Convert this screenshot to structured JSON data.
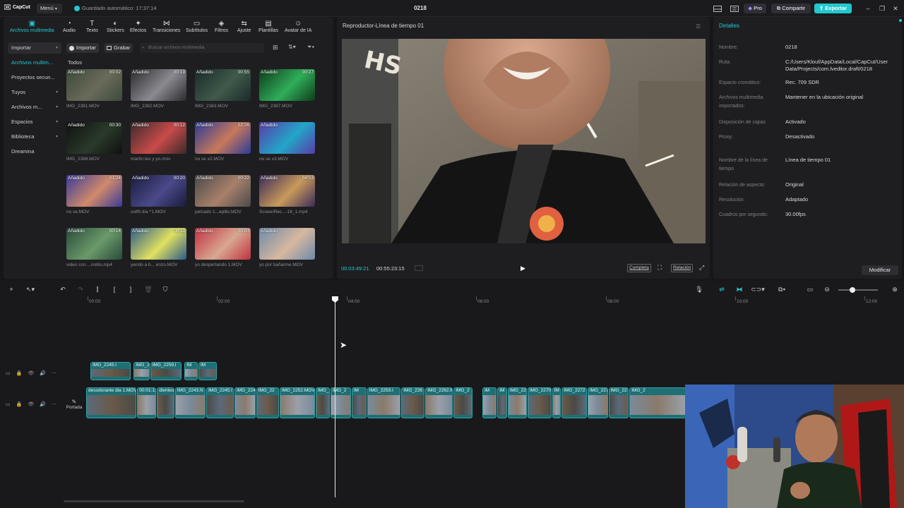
{
  "topbar": {
    "logo": "CapCut",
    "menu": "Menú",
    "autosave": "Guardado automático: 17:37:14",
    "project_name": "0218",
    "pro": "Pro",
    "share": "Compartir",
    "export": "Exportar"
  },
  "toolbar": [
    {
      "label": "Archivos multimedia",
      "icon": "media-icon",
      "active": true
    },
    {
      "label": "Audio",
      "icon": "audio-icon"
    },
    {
      "label": "Texto",
      "icon": "text-icon"
    },
    {
      "label": "Stickers",
      "icon": "stickers-icon"
    },
    {
      "label": "Efectos",
      "icon": "effects-icon"
    },
    {
      "label": "Transiciones",
      "icon": "transitions-icon"
    },
    {
      "label": "Subtítulos",
      "icon": "subtitles-icon"
    },
    {
      "label": "Filtros",
      "icon": "filters-icon"
    },
    {
      "label": "Ajuste",
      "icon": "adjust-icon"
    },
    {
      "label": "Plantillas",
      "icon": "templates-icon"
    },
    {
      "label": "Avatar de IA",
      "icon": "ai-avatar-icon"
    }
  ],
  "sidebar": [
    {
      "label": "Importar",
      "chevron": true,
      "selected": true
    },
    {
      "label": "Archivos multim...",
      "active": true
    },
    {
      "label": "Proyectos secun..."
    },
    {
      "label": "Tuyos",
      "chevron": true
    },
    {
      "label": "Archivos m...",
      "chevron": true
    },
    {
      "label": "Espacios",
      "chevron": true
    },
    {
      "label": "Biblioteca",
      "chevron": true
    },
    {
      "label": "Dreamina"
    }
  ],
  "media_panel": {
    "import_btn": "Importar",
    "record_btn": "Grabar",
    "search_placeholder": "Buscar archivos multimedia",
    "section": "Todos",
    "added_label": "Añadido",
    "clips": [
      {
        "name": "IMG_2381.MOV",
        "duration": "00:02",
        "colors": [
          "#3c4a3a",
          "#6a6a5a"
        ]
      },
      {
        "name": "IMG_2382.MOV",
        "duration": "00:19",
        "colors": [
          "#2a2a2e",
          "#8a8a90"
        ]
      },
      {
        "name": "IMG_2383.MOV",
        "duration": "00:55",
        "colors": [
          "#1a2a2a",
          "#3f5a4a"
        ]
      },
      {
        "name": "IMG_2387.MOV",
        "duration": "00:27",
        "colors": [
          "#0f3a1a",
          "#2fae5a"
        ]
      },
      {
        "name": "IMG_2388.MOV",
        "duration": "00:30",
        "colors": [
          "#101010",
          "#2a3a2a"
        ]
      },
      {
        "name": "martin leo y yo.mov",
        "duration": "00:12",
        "colors": [
          "#3a2a2a",
          "#c94a4a"
        ]
      },
      {
        "name": "no se x2.MOV",
        "duration": "02:26",
        "colors": [
          "#2a3a9a",
          "#c8785a"
        ]
      },
      {
        "name": "no se x3.MOV",
        "duration": "",
        "colors": [
          "#5a3aaa",
          "#22a6c8"
        ]
      },
      {
        "name": "no se.MOV",
        "duration": "01:24",
        "colors": [
          "#3a3a9a",
          "#d08a6a"
        ]
      },
      {
        "name": "outfit dia ^1.MOV",
        "duration": "00:20",
        "colors": [
          "#1a1a3a",
          "#4a4a8a"
        ]
      },
      {
        "name": "peinado 1...epillo.MOV",
        "duration": "00:22",
        "colors": [
          "#4a4a4a",
          "#a8806a"
        ]
      },
      {
        "name": "ScreenRec...-16_1.mp4",
        "duration": "04:53",
        "colors": [
          "#3a2a5a",
          "#c89a5a"
        ]
      },
      {
        "name": "video con ...nolito.mp4",
        "duration": "00:14",
        "colors": [
          "#2a4a3a",
          "#6a9a6a"
        ]
      },
      {
        "name": "yendo a b... enzo.MOV",
        "duration": "00:11",
        "colors": [
          "#2a5a8a",
          "#e0e060"
        ]
      },
      {
        "name": "yo despertando 1.MOV",
        "duration": "00:03",
        "colors": [
          "#c03040",
          "#d8a890"
        ]
      },
      {
        "name": "yo por bañarme.MOV",
        "duration": "",
        "colors": [
          "#6a8aaa",
          "#d8b8a0"
        ]
      }
    ]
  },
  "player": {
    "title": "Reproductor-Línea de tiempo 01",
    "current_time": "00:03:49:21",
    "total_time": "00:55:23:15",
    "full_btn": "Completa",
    "ratio_btn": "Relación"
  },
  "details": {
    "title": "Detalles",
    "rows": [
      {
        "label": "Nombre:",
        "value": "0218"
      },
      {
        "label": "Ruta:",
        "value": "C:/Users/Klouf/AppData/Local/CapCut/User Data/Projects/com.lveditor.draft/0218"
      },
      {
        "label": "Espacio cromático:",
        "value": "Rec. 709 SDR"
      },
      {
        "label": "Archivos multimedia importados:",
        "value": "Mantener en la ubicación original"
      },
      {
        "label": "Disposición de capas",
        "value": "Activado"
      },
      {
        "label": "Proxy:",
        "value": "Desactivado"
      },
      {
        "label": "Nombre de la línea de tiempo",
        "value": "Línea de tiempo 01"
      },
      {
        "label": "Relación de aspecto:",
        "value": "Original"
      },
      {
        "label": "Resolución:",
        "value": "Adaptado"
      },
      {
        "label": "Cuadros por segundo:",
        "value": "30.00fps"
      }
    ],
    "modify_btn": "Modificar"
  },
  "timeline": {
    "ruler": [
      "00:00",
      "02:00",
      "04:00",
      "06:00",
      "08:00",
      "10:00",
      "12:00"
    ],
    "cover_label": "Portada",
    "overlay_clips": [
      {
        "label": "IMG_2245.I",
        "start": 0.0,
        "end": 0.32
      },
      {
        "label": "IMG_2",
        "start": 0.34,
        "end": 0.47
      },
      {
        "label": "IMG_2259.I",
        "start": 0.47,
        "end": 0.72
      },
      {
        "label": "IM",
        "start": 0.74,
        "end": 0.85
      },
      {
        "label": "IM",
        "start": 0.85,
        "end": 1.0
      }
    ],
    "main_clips": [
      {
        "label": "desodorante dia 1.MOV",
        "start": 0.0,
        "end": 0.085
      },
      {
        "label": "00:01:11",
        "start": 0.085,
        "end": 0.118
      },
      {
        "label": "dientes i",
        "start": 0.118,
        "end": 0.148
      },
      {
        "label": "IMG_2243.N",
        "start": 0.148,
        "end": 0.2
      },
      {
        "label": "IMG_2245.I",
        "start": 0.2,
        "end": 0.247
      },
      {
        "label": "IMG_224",
        "start": 0.247,
        "end": 0.283
      },
      {
        "label": "IMG_22",
        "start": 0.283,
        "end": 0.322
      },
      {
        "label": "IMG_2252.MOV",
        "start": 0.322,
        "end": 0.382
      },
      {
        "label": "IMG_",
        "start": 0.382,
        "end": 0.407
      },
      {
        "label": "IMG_2",
        "start": 0.407,
        "end": 0.442
      },
      {
        "label": "IM",
        "start": 0.442,
        "end": 0.468
      },
      {
        "label": "IMG_2259.I",
        "start": 0.468,
        "end": 0.525
      },
      {
        "label": "IMG_226",
        "start": 0.525,
        "end": 0.565
      },
      {
        "label": "IMG_2262.MOV",
        "start": 0.565,
        "end": 0.612
      },
      {
        "label": "IMG_2",
        "start": 0.612,
        "end": 0.645
      },
      {
        "label": "IM",
        "start": 0.66,
        "end": 0.685
      },
      {
        "label": "IM",
        "start": 0.685,
        "end": 0.702
      },
      {
        "label": "IMG_22",
        "start": 0.702,
        "end": 0.735
      },
      {
        "label": "IMG_2270.",
        "start": 0.735,
        "end": 0.776
      },
      {
        "label": "IM",
        "start": 0.776,
        "end": 0.792
      },
      {
        "label": "IMG_2272",
        "start": 0.792,
        "end": 0.835
      },
      {
        "label": "IMG_2273",
        "start": 0.835,
        "end": 0.87
      },
      {
        "label": "IMG_227",
        "start": 0.87,
        "end": 0.905
      },
      {
        "label": "IMG_2",
        "start": 0.905,
        "end": 1.0
      }
    ]
  },
  "colors": {
    "accent": "#22c8d0",
    "clip": "#1f6f74",
    "clip_border": "#2ba3aa"
  }
}
